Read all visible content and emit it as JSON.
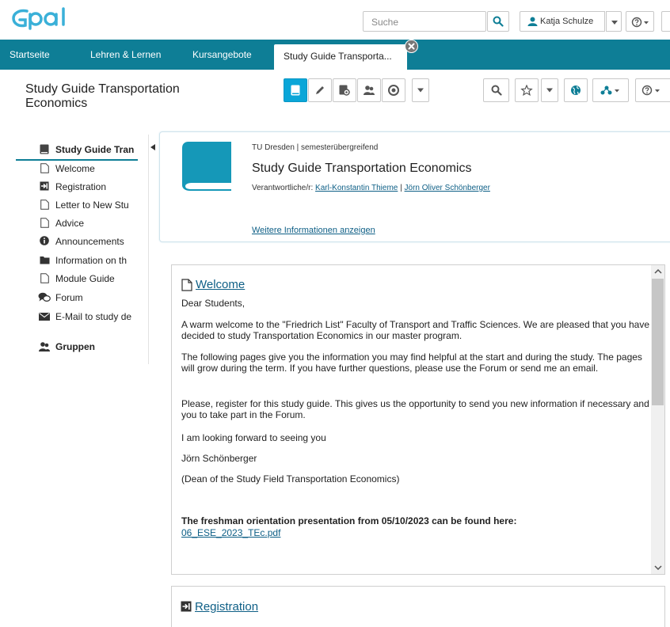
{
  "header": {
    "logo_text": "Opal",
    "search_placeholder": "Suche",
    "user_name": "Katja Schulze"
  },
  "nav": {
    "links": [
      "Startseite",
      "Lehren & Lernen",
      "Kursangebote"
    ],
    "active_tab": "Study Guide Transporta..."
  },
  "course": {
    "toolbar_title": "Study Guide Transportation Economics"
  },
  "sidebar": {
    "items": [
      {
        "label": "Study Guide Tran",
        "icon": "book-icon",
        "bold": true
      },
      {
        "label": "Welcome",
        "icon": "page-icon"
      },
      {
        "label": "Registration",
        "icon": "enrollment-icon"
      },
      {
        "label": "Letter to New Stu",
        "icon": "page-icon"
      },
      {
        "label": "Advice",
        "icon": "page-icon"
      },
      {
        "label": "Announcements",
        "icon": "info-icon"
      },
      {
        "label": "Information on th",
        "icon": "folder-icon"
      },
      {
        "label": "Module Guide",
        "icon": "page-icon"
      },
      {
        "label": "Forum",
        "icon": "forum-icon"
      },
      {
        "label": "E-Mail to study de",
        "icon": "mail-icon"
      },
      {
        "label": "Gruppen",
        "icon": "groups-icon",
        "bold": true
      }
    ]
  },
  "info": {
    "org": "TU Dresden | semesterübergreifend",
    "title": "Study Guide Transportation Economics",
    "responsible_label": "Verantwortliche/r:",
    "responsible_1": "Karl-Konstantin Thieme",
    "separator": "|",
    "responsible_2": "Jörn Oliver Schönberger",
    "more_link": "Weitere Informationen anzeigen"
  },
  "welcome": {
    "heading": "Welcome",
    "p1": "Dear Students,",
    "p2": "A warm welcome to the \"Friedrich List\" Faculty of Transport and Traffic Sciences. We are pleased that you have decided to study Transportation Economics in our master program.",
    "p3": "The following pages give you the information you may find helpful at the start and during the study. The pages will grow during the term. If you have further questions, please use the Forum or send me an email.",
    "p4": "Please, register for this study guide. This gives us the opportunity to send you new information if necessary and you to take part in the Forum.",
    "p5": "I am looking forward to seeing you",
    "p6": "Jörn Schönberger",
    "p7": "(Dean of the Study Field Transportation Economics)",
    "p8": "The freshman orientation presentation from 05/10/2023 can be found here:",
    "pdf": "06_ESE_2023_TEc.pdf"
  },
  "registration": {
    "heading": "Registration"
  },
  "colors": {
    "brand": "#0e7e96",
    "active_button": "#0aa6d8",
    "link": "#0e5f86"
  }
}
